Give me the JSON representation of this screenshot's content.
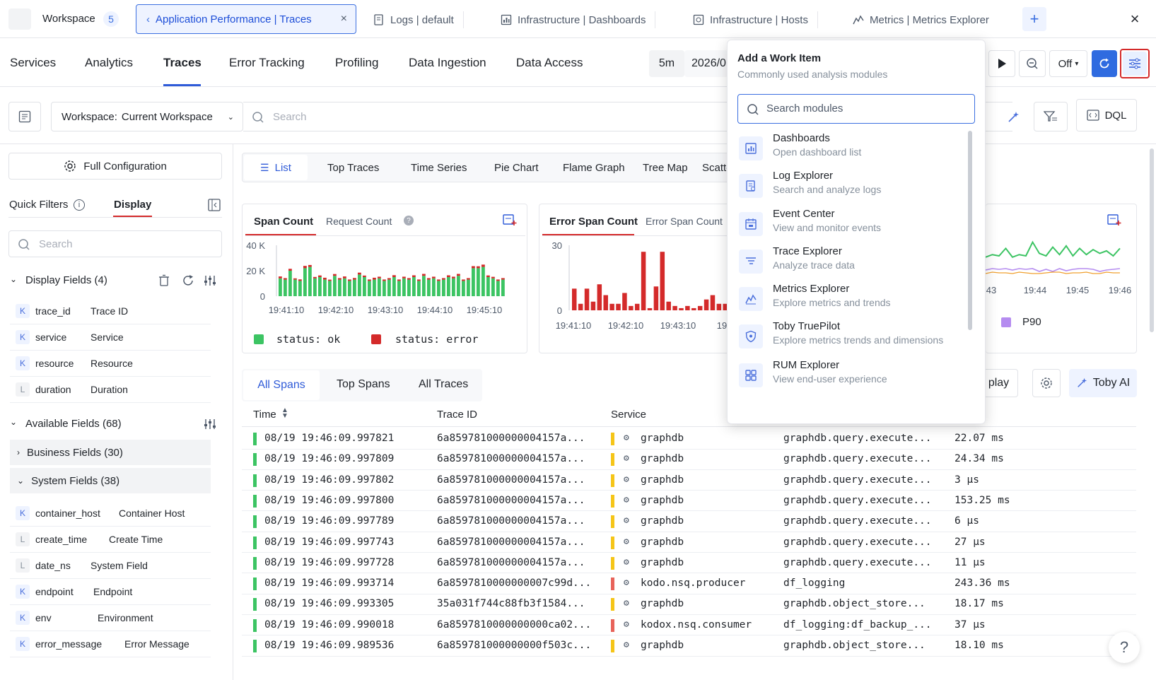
{
  "tabs": {
    "workspace_label": "Workspace",
    "workspace_count": "5",
    "items": [
      {
        "label": "Application Performance | Traces"
      },
      {
        "label": "Logs | default"
      },
      {
        "label": "Infrastructure | Dashboards"
      },
      {
        "label": "Infrastructure | Hosts"
      },
      {
        "label": "Metrics | Metrics Explorer"
      }
    ]
  },
  "nav": {
    "items": [
      "Services",
      "Analytics",
      "Traces",
      "Error Tracking",
      "Profiling",
      "Data Ingestion",
      "Data Access"
    ],
    "active": "Traces",
    "time_range": "5m",
    "date_value": "2026/0",
    "refresh_mode": "Off"
  },
  "filter": {
    "workspace_prefix": "Workspace:",
    "workspace_value": "Current Workspace",
    "search_placeholder": "Search",
    "dql_label": "DQL"
  },
  "left": {
    "full_config": "Full Configuration",
    "tab_quick_filters": "Quick Filters",
    "tab_display": "Display",
    "search_placeholder": "Search",
    "display_fields_title": "Display Fields (4)",
    "display_fields": [
      {
        "type": "K",
        "name": "trace_id",
        "label": "Trace ID"
      },
      {
        "type": "K",
        "name": "service",
        "label": "Service"
      },
      {
        "type": "K",
        "name": "resource",
        "label": "Resource"
      },
      {
        "type": "L",
        "name": "duration",
        "label": "Duration"
      }
    ],
    "available_title": "Available Fields (68)",
    "business_fields": "Business Fields (30)",
    "system_fields": "System Fields (38)",
    "system_list": [
      {
        "type": "K",
        "name": "container_host",
        "label": "Container Host"
      },
      {
        "type": "L",
        "name": "create_time",
        "label": "Create Time"
      },
      {
        "type": "L",
        "name": "date_ns",
        "label": "System Field"
      },
      {
        "type": "K",
        "name": "endpoint",
        "label": "Endpoint"
      },
      {
        "type": "K",
        "name": "env",
        "label": "Environment"
      },
      {
        "type": "K",
        "name": "error_message",
        "label": "Error Message"
      }
    ]
  },
  "views": {
    "items": [
      "List",
      "Top Traces",
      "Time Series",
      "Pie Chart",
      "Flame Graph",
      "Tree Map",
      "Scatte"
    ],
    "active": "List"
  },
  "card1": {
    "tab_active": "Span Count",
    "tab_other": "Request Count",
    "legend_ok": "status: ok",
    "legend_error": "status: error",
    "ok_color": "#3cc463",
    "error_color": "#d42a2a"
  },
  "card2": {
    "tab_active": "Error Span Count",
    "tab_other": "Error Span Count"
  },
  "card3": {
    "legend": "P90",
    "legend_color": "#b58cf0"
  },
  "chart_data": [
    {
      "type": "bar",
      "title": "Span Count",
      "yticks": [
        "40 K",
        "20 K",
        "0"
      ],
      "ylim": [
        0,
        40000
      ],
      "xticks": [
        "19:41:10",
        "19:42:10",
        "19:43:10",
        "19:44:10",
        "19:45:10"
      ],
      "series": [
        {
          "name": "status: ok",
          "values": [
            14000,
            13000,
            20000,
            13000,
            12000,
            22000,
            23000,
            14000,
            15000,
            13000,
            12000,
            16000,
            13000,
            14000,
            12000,
            13000,
            17000,
            15000,
            12000,
            13000,
            14000,
            12000,
            13000,
            15000,
            12000,
            14000,
            13000,
            15000,
            12000,
            16000,
            13000,
            14000,
            12000,
            13000,
            15000,
            14000,
            16000,
            12000,
            13000,
            22000,
            22000,
            23000,
            15000,
            14000,
            12000,
            13000
          ]
        },
        {
          "name": "status: error",
          "values": [
            1500,
            1200,
            1500,
            1000,
            1200,
            1800,
            1500,
            1100,
            1300,
            1500,
            1000,
            1400,
            1200,
            1500,
            1100,
            1300,
            1500,
            1200,
            1100,
            1500,
            1300,
            1100,
            1200,
            1500,
            1100,
            1300,
            1200,
            1400,
            1100,
            1500,
            1200,
            1300,
            1100,
            1200,
            1400,
            1300,
            1500,
            1100,
            1200,
            1600,
            1500,
            1800,
            1300,
            1200,
            1100,
            1200
          ]
        }
      ]
    },
    {
      "type": "bar",
      "title": "Error Span Count",
      "yticks": [
        "30",
        "0"
      ],
      "ylim": [
        0,
        30
      ],
      "xticks": [
        "19:41:10",
        "19:42:10",
        "19:43:10",
        "19"
      ],
      "series": [
        {
          "name": "status: error",
          "values": [
            10,
            3,
            10,
            4,
            12,
            7,
            3,
            3,
            8,
            2,
            3,
            27,
            1,
            11,
            27,
            4,
            2,
            1,
            2,
            1,
            2,
            5,
            7,
            3,
            3,
            2,
            2,
            2,
            9
          ]
        }
      ]
    },
    {
      "type": "line",
      "xticks": [
        "43",
        "19:44",
        "19:45",
        "19:46"
      ],
      "series": [
        {
          "name": "P90",
          "values": [
            12,
            14,
            13,
            19,
            12,
            14,
            13,
            24,
            15,
            13,
            20,
            14,
            21,
            13,
            19,
            14,
            18,
            15,
            17,
            13,
            19
          ]
        }
      ]
    }
  ],
  "subtabs": {
    "items": [
      "All Spans",
      "Top Spans",
      "All Traces"
    ],
    "active": "All Spans",
    "display_partial": "play",
    "toby_ai": "Toby AI"
  },
  "table": {
    "headers": {
      "time": "Time",
      "trace_id": "Trace ID",
      "service": "Service"
    },
    "rows": [
      {
        "time": "08/19  19:46:09.997821",
        "trace_id": "6a859781000000004157a...",
        "service": "graphdb",
        "svc_color": "#f5c518",
        "resource": "graphdb.query.execute...",
        "duration": "22.07 ms"
      },
      {
        "time": "08/19  19:46:09.997809",
        "trace_id": "6a859781000000004157a...",
        "service": "graphdb",
        "svc_color": "#f5c518",
        "resource": "graphdb.query.execute...",
        "duration": "24.34 ms"
      },
      {
        "time": "08/19  19:46:09.997802",
        "trace_id": "6a859781000000004157a...",
        "service": "graphdb",
        "svc_color": "#f5c518",
        "resource": "graphdb.query.execute...",
        "duration": "3 μs"
      },
      {
        "time": "08/19  19:46:09.997800",
        "trace_id": "6a859781000000004157a...",
        "service": "graphdb",
        "svc_color": "#f5c518",
        "resource": "graphdb.query.execute...",
        "duration": "153.25 ms"
      },
      {
        "time": "08/19  19:46:09.997789",
        "trace_id": "6a859781000000004157a...",
        "service": "graphdb",
        "svc_color": "#f5c518",
        "resource": "graphdb.query.execute...",
        "duration": "6 μs"
      },
      {
        "time": "08/19  19:46:09.997743",
        "trace_id": "6a859781000000004157a...",
        "service": "graphdb",
        "svc_color": "#f5c518",
        "resource": "graphdb.query.execute...",
        "duration": "27 μs"
      },
      {
        "time": "08/19  19:46:09.997728",
        "trace_id": "6a859781000000004157a...",
        "service": "graphdb",
        "svc_color": "#f5c518",
        "resource": "graphdb.query.execute...",
        "duration": "11 μs"
      },
      {
        "time": "08/19  19:46:09.993714",
        "trace_id": "6a8597810000000007c99d...",
        "service": "kodo.nsq.producer",
        "svc_color": "#e8635a",
        "resource": "df_logging",
        "duration": "243.36 ms"
      },
      {
        "time": "08/19  19:46:09.993305",
        "trace_id": "35a031f744c88fb3f1584...",
        "service": "graphdb",
        "svc_color": "#f5c518",
        "resource": "graphdb.object_store...",
        "duration": "18.17 ms"
      },
      {
        "time": "08/19  19:46:09.990018",
        "trace_id": "6a8597810000000000ca02...",
        "service": "kodox.nsq.consumer",
        "svc_color": "#e8635a",
        "resource": "df_logging:df_backup_...",
        "duration": "37 μs"
      },
      {
        "time": "08/19  19:46:09.989536",
        "trace_id": "6a859781000000000f503c...",
        "service": "graphdb",
        "svc_color": "#f5c518",
        "resource": "graphdb.object_store...",
        "duration": "18.10 ms"
      }
    ]
  },
  "dropdown": {
    "title": "Add a Work Item",
    "subtitle": "Commonly used analysis modules",
    "search_placeholder": "Search modules",
    "modules": [
      {
        "title": "Dashboards",
        "desc": "Open dashboard list",
        "icon": "dashboard-icon"
      },
      {
        "title": "Log Explorer",
        "desc": "Search and analyze logs",
        "icon": "log-icon"
      },
      {
        "title": "Event Center",
        "desc": "View and monitor events",
        "icon": "calendar-icon"
      },
      {
        "title": "Trace Explorer",
        "desc": "Analyze trace data",
        "icon": "trace-icon"
      },
      {
        "title": "Metrics Explorer",
        "desc": "Explore metrics and trends",
        "icon": "metrics-icon"
      },
      {
        "title": "Toby TruePilot",
        "desc": "Explore metrics trends and dimensions",
        "icon": "shield-icon"
      },
      {
        "title": "RUM Explorer",
        "desc": "View end-user experience",
        "icon": "grid-icon"
      }
    ]
  },
  "help_label": "?"
}
